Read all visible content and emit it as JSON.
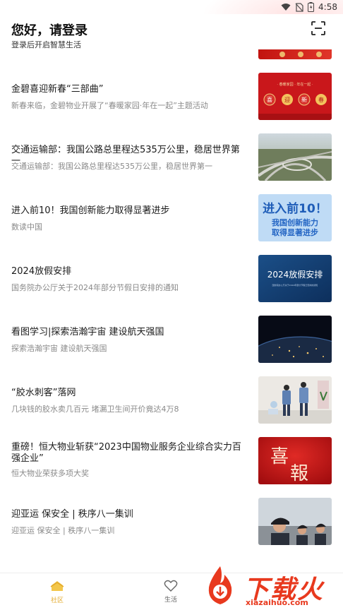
{
  "status_bar": {
    "time": "4:58",
    "icons": [
      "wifi-icon",
      "no-sim-icon",
      "battery-icon"
    ]
  },
  "header": {
    "greeting": "您好，请登录",
    "subtitle": "登录后开启智慧生活",
    "scan_icon": "scan-icon"
  },
  "feed": [
    {
      "title": "金碧喜迎新春“三部曲”",
      "subtitle": "新春来临，金碧物业开展了“春暖家园·年在一起”主题活动",
      "thumb": {
        "kind": "newyear",
        "banner": "· 春暖家园 · 年在一起 ·",
        "chars": [
          "喜",
          "迎",
          "新",
          "春"
        ]
      }
    },
    {
      "title": "交通运输部：我国公路总里程达535万公里，稳居世界第一",
      "subtitle": "交通运输部：我国公路总里程达535万公里，稳居世界第一",
      "thumb": {
        "kind": "highway"
      }
    },
    {
      "title": "进入前10！我国创新能力取得显著进步",
      "subtitle": "数读中国",
      "thumb": {
        "kind": "textcard",
        "line1": "进入前10！",
        "line2": "我国创新能力",
        "line3": "取得显著进步"
      }
    },
    {
      "title": "2024放假安排",
      "subtitle": "国务院办公厅关于2024年部分节假日安排的通知",
      "thumb": {
        "kind": "holiday",
        "line1": "2024放假安排",
        "line2": "国务院办公厅关于2024年部分节假日安排的通知"
      }
    },
    {
      "title": "看图学习|探索浩瀚宇宙 建设航天强国",
      "subtitle": "探索浩瀚宇宙 建设航天强国",
      "thumb": {
        "kind": "earth"
      }
    },
    {
      "title": "“胶水刺客”落网",
      "subtitle": "几块钱的胶水卖几百元 堵漏卫生间开价竟达4万8",
      "thumb": {
        "kind": "police"
      }
    },
    {
      "title": "重磅！恒大物业斩获“2023中国物业服务企业综合实力百强企业”",
      "subtitle": "恒大物业荣获多项大奖",
      "thumb": {
        "kind": "xibao",
        "chars": [
          "喜",
          "報"
        ]
      }
    },
    {
      "title": "迎亚运  保安全 | 秩序八一集训",
      "subtitle": "迎亚运  保安全 | 秩序八一集训",
      "thumb": {
        "kind": "guards"
      }
    }
  ],
  "tabbar": {
    "tabs": [
      {
        "label": "社区",
        "icon": "community-icon",
        "active": true
      },
      {
        "label": "生活",
        "icon": "heart-icon",
        "active": false
      }
    ]
  },
  "watermark": {
    "text": "下载火",
    "url": "xiazaihuo.com"
  },
  "colors": {
    "accent": "#e3a92a",
    "watermark": "#e8391e",
    "title": "#1a1a1a",
    "subtitle": "#8a8a8a"
  }
}
